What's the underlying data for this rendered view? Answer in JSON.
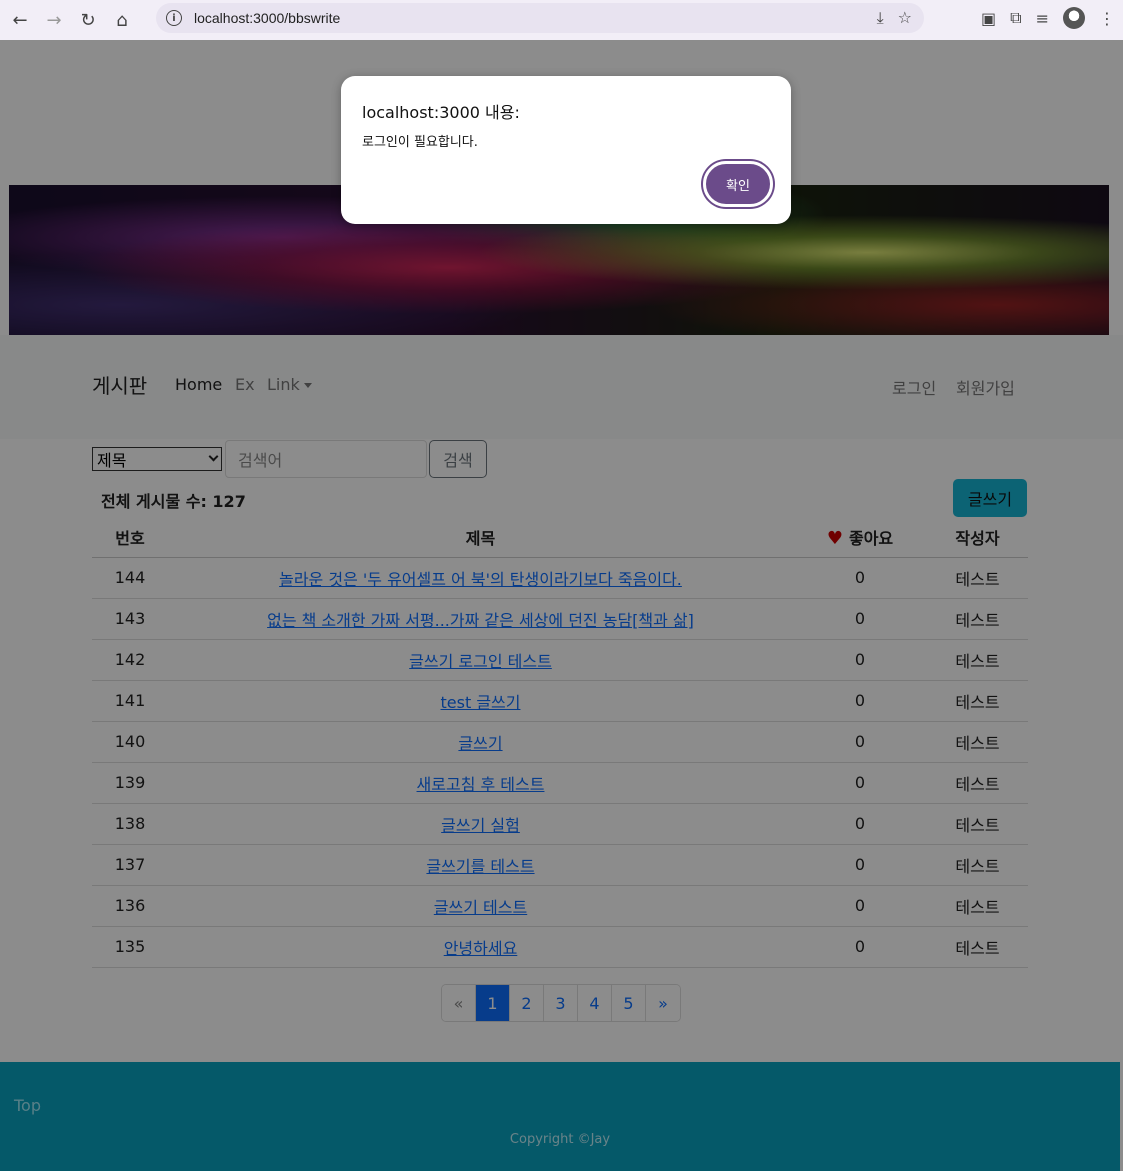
{
  "browser": {
    "url": "localhost:3000/bbswrite"
  },
  "navbar": {
    "brand": "게시판",
    "home": "Home",
    "ex": "Ex",
    "link": "Link",
    "login": "로그인",
    "signup": "회원가입"
  },
  "search": {
    "select_value": "제목",
    "placeholder": "검색어",
    "button": "검색"
  },
  "board": {
    "total_label": "전체 게시물 수: 127",
    "write_button": "글쓰기",
    "headers": {
      "no": "번호",
      "title": "제목",
      "likes": "좋아요",
      "author": "작성자"
    },
    "rows": [
      {
        "no": "144",
        "title": "놀라운 것은 '두 유어셀프 어 북'의 탄생이라기보다 죽음이다.",
        "likes": "0",
        "author": "테스트"
      },
      {
        "no": "143",
        "title": "없는 책 소개한 가짜 서평...가짜 같은 세상에 던진 농담[책과 삶]",
        "likes": "0",
        "author": "테스트"
      },
      {
        "no": "142",
        "title": "글쓰기 로그인 테스트",
        "likes": "0",
        "author": "테스트"
      },
      {
        "no": "141",
        "title": "test 글쓰기",
        "likes": "0",
        "author": "테스트"
      },
      {
        "no": "140",
        "title": "글쓰기",
        "likes": "0",
        "author": "테스트"
      },
      {
        "no": "139",
        "title": "새로고침 후 테스트",
        "likes": "0",
        "author": "테스트"
      },
      {
        "no": "138",
        "title": "글쓰기 실험",
        "likes": "0",
        "author": "테스트"
      },
      {
        "no": "137",
        "title": "글쓰기를 테스트",
        "likes": "0",
        "author": "테스트"
      },
      {
        "no": "136",
        "title": "글쓰기 테스트",
        "likes": "0",
        "author": "테스트"
      },
      {
        "no": "135",
        "title": "안녕하세요",
        "likes": "0",
        "author": "테스트"
      }
    ]
  },
  "pagination": {
    "prev": "«",
    "pages": [
      "1",
      "2",
      "3",
      "4",
      "5"
    ],
    "active_page": "1",
    "next": "»"
  },
  "footer": {
    "top_link": "Top",
    "copyright": "Copyright ©Jay"
  },
  "dialog": {
    "title": "localhost:3000 내용:",
    "message": "로그인이 필요합니다.",
    "ok_button": "확인"
  },
  "colors": {
    "dialog_button": "#6b4b8a",
    "write_button": "#16b4d4",
    "footer": "#0aa2c0",
    "link": "#0d6efd"
  }
}
